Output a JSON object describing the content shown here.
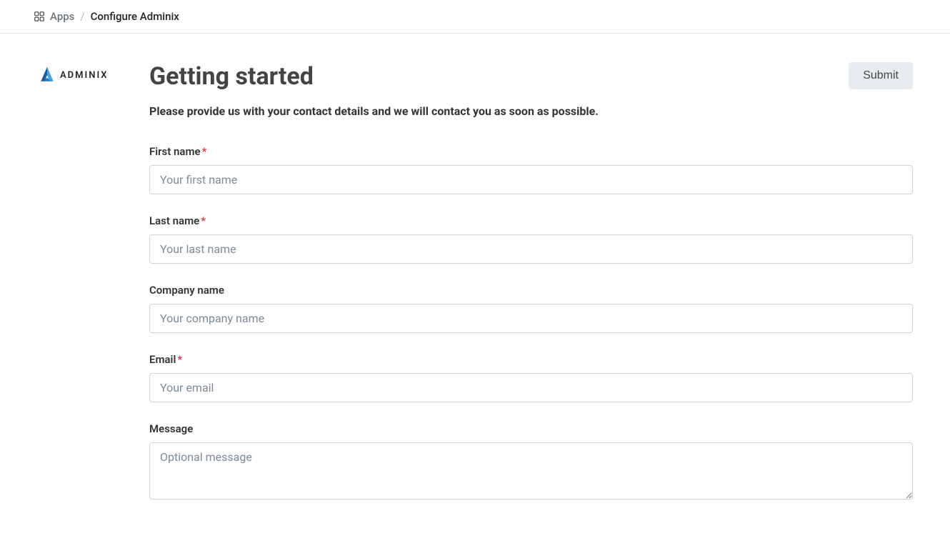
{
  "breadcrumb": {
    "link": "Apps",
    "separator": "/",
    "current": "Configure Adminix"
  },
  "logo": {
    "text": "ADMINIX"
  },
  "header": {
    "title": "Getting started",
    "submit_label": "Submit"
  },
  "subtitle": "Please provide us with your contact details and we will contact you as soon as possible.",
  "form": {
    "first_name": {
      "label": "First name",
      "placeholder": "Your first name",
      "required": true
    },
    "last_name": {
      "label": "Last name",
      "placeholder": "Your last name",
      "required": true
    },
    "company_name": {
      "label": "Company name",
      "placeholder": "Your company name",
      "required": false
    },
    "email": {
      "label": "Email",
      "placeholder": "Your email",
      "required": true
    },
    "message": {
      "label": "Message",
      "placeholder": "Optional message",
      "required": false
    }
  }
}
